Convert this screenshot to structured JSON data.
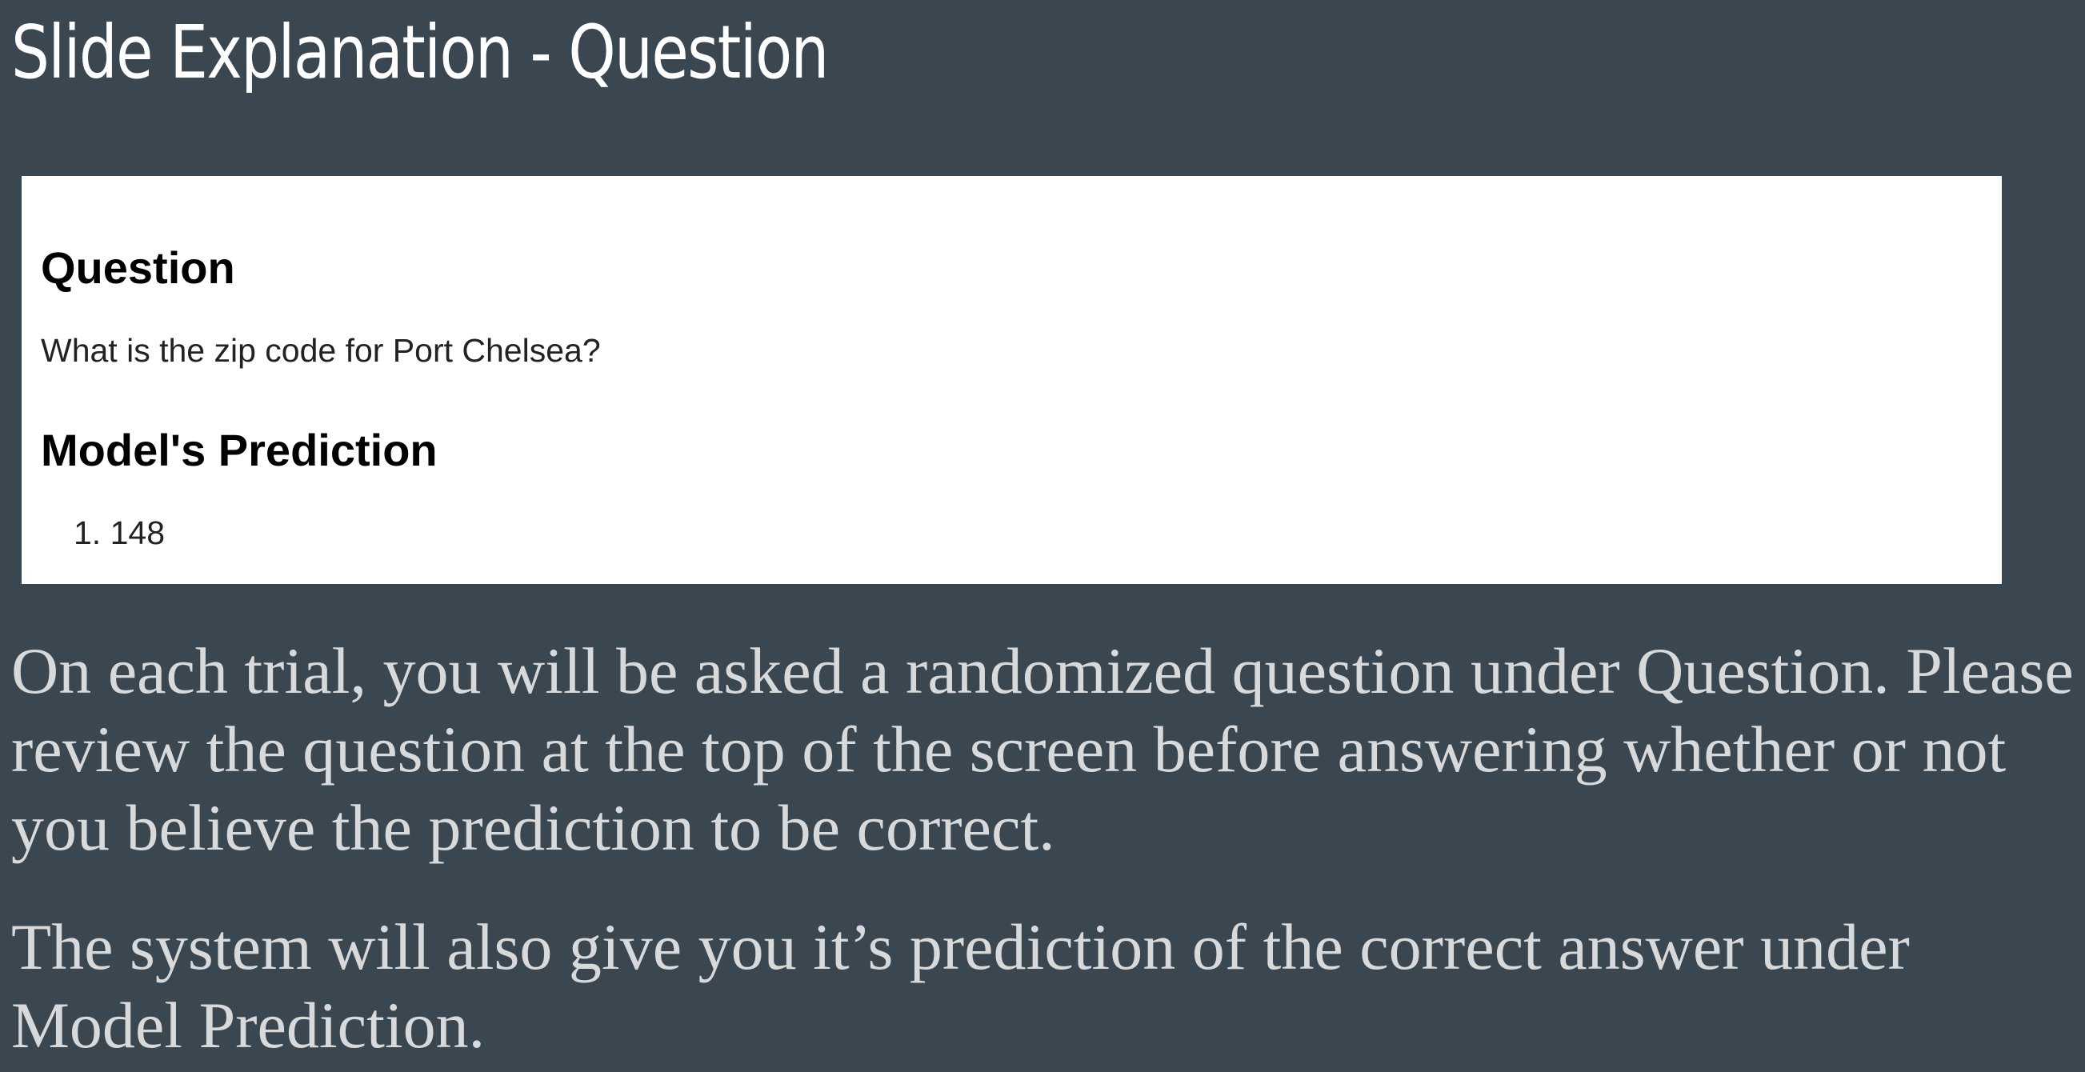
{
  "slide": {
    "title": "Slide Explanation - Question"
  },
  "panel": {
    "question_heading": "Question",
    "question_text": "What is the zip code for Port Chelsea?",
    "prediction_heading": "Model's Prediction",
    "predictions": [
      {
        "number": "1.",
        "value": "148"
      }
    ]
  },
  "explanation": {
    "paragraph_1": "On each trial, you will be asked a randomized question under Question. Please review the question at the top of the screen before answering whether or not you believe the prediction to be correct.",
    "paragraph_2": "The system will also give you it’s prediction of the correct answer under Model Prediction."
  },
  "colors": {
    "background": "#3b4750",
    "title": "#ffffff",
    "body_text": "#d7d9da",
    "panel_background": "#ffffff"
  }
}
